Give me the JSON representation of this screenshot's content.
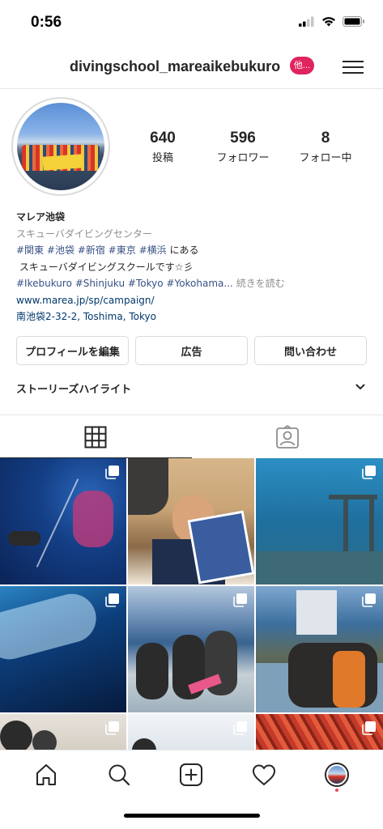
{
  "status_bar": {
    "time": "0:56"
  },
  "header": {
    "username": "divingschool_mareaikebukuro",
    "badge": "他..."
  },
  "stats": [
    {
      "value": "640",
      "label": "投稿"
    },
    {
      "value": "596",
      "label": "フォロワー"
    },
    {
      "value": "8",
      "label": "フォロー中"
    }
  ],
  "bio": {
    "name": "マレア池袋",
    "category": "スキューバダイビングセンター",
    "line1_tags": [
      "#関東",
      "#池袋",
      "#新宿",
      "#東京",
      "#横浜"
    ],
    "line1_suffix": "にある",
    "line2": " スキューバダイビングスクールです☆彡",
    "line3_tags": [
      "#Ikebukuro",
      "#Shinjuku",
      "#Tokyo",
      "#Yokohama..."
    ],
    "more": "続きを読む",
    "website": "www.marea.jp/sp/campaign/",
    "address": "南池袋2-32-2, Toshima, Tokyo"
  },
  "buttons": {
    "edit_profile": "プロフィールを編集",
    "ads": "広告",
    "contact": "問い合わせ"
  },
  "highlights": {
    "label": "ストーリーズハイライト"
  },
  "tabs": [
    {
      "icon": "grid-icon",
      "active": true
    },
    {
      "icon": "tagged-icon",
      "active": false
    }
  ],
  "posts": [
    {
      "multi": true
    },
    {
      "multi": false
    },
    {
      "multi": true
    },
    {
      "multi": true
    },
    {
      "multi": true
    },
    {
      "multi": true
    },
    {
      "multi": true
    },
    {
      "multi": true
    },
    {
      "multi": true
    }
  ],
  "bottom_nav": [
    "home-icon",
    "search-icon",
    "new-post-icon",
    "activity-icon",
    "profile-avatar"
  ],
  "colors": {
    "link": "#385185",
    "badge": "#e0245e",
    "notification_dot": "#ed4956"
  }
}
